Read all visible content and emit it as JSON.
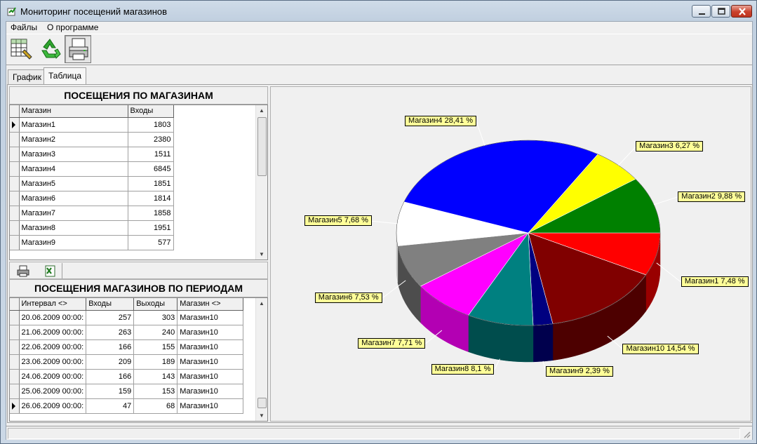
{
  "window": {
    "title": "Мониторинг посещений магазинов"
  },
  "menu": {
    "files": "Файлы",
    "about": "О программе"
  },
  "toolbar": {
    "buttons": [
      "table-grid-icon",
      "recycle-icon",
      "printer-icon"
    ]
  },
  "tabs": [
    {
      "label": "График"
    },
    {
      "label": "Таблица"
    }
  ],
  "visits_by_store": {
    "title": "ПОСЕЩЕНИЯ ПО МАГАЗИНАМ",
    "columns": [
      "Магазин",
      "Входы"
    ],
    "rows": [
      {
        "store": "Магазин1",
        "entries": "1803"
      },
      {
        "store": "Магазин2",
        "entries": "2380"
      },
      {
        "store": "Магазин3",
        "entries": "1511"
      },
      {
        "store": "Магазин4",
        "entries": "6845"
      },
      {
        "store": "Магазин5",
        "entries": "1851"
      },
      {
        "store": "Магазин6",
        "entries": "1814"
      },
      {
        "store": "Магазин7",
        "entries": "1858"
      },
      {
        "store": "Магазин8",
        "entries": "1951"
      },
      {
        "store": "Магазин9",
        "entries": "577"
      }
    ]
  },
  "visits_by_period": {
    "title": "ПОСЕЩЕНИЯ МАГАЗИНОВ ПО ПЕРИОДАМ",
    "columns": [
      "Интервал <>",
      "Входы",
      "Выходы",
      "Магазин <>"
    ],
    "rows": [
      {
        "interval": "20.06.2009 00:00:",
        "entries": "257",
        "exits": "303",
        "store": "Магазин10"
      },
      {
        "interval": "21.06.2009 00:00:",
        "entries": "263",
        "exits": "240",
        "store": "Магазин10"
      },
      {
        "interval": "22.06.2009 00:00:",
        "entries": "166",
        "exits": "155",
        "store": "Магазин10"
      },
      {
        "interval": "23.06.2009 00:00:",
        "entries": "209",
        "exits": "189",
        "store": "Магазин10"
      },
      {
        "interval": "24.06.2009 00:00:",
        "entries": "166",
        "exits": "143",
        "store": "Магазин10"
      },
      {
        "interval": "25.06.2009 00:00:",
        "entries": "159",
        "exits": "153",
        "store": "Магазин10"
      },
      {
        "interval": "26.06.2009 00:00:",
        "entries": "47",
        "exits": "68",
        "store": "Магазин10"
      }
    ]
  },
  "chart_data": {
    "type": "pie",
    "slices": [
      {
        "label": "Магазин1 7,48 %",
        "value": 7.48,
        "color": "#ff0000",
        "dark": "#990000"
      },
      {
        "label": "Магазин10 14,54 %",
        "value": 14.54,
        "color": "#800000",
        "dark": "#4d0000"
      },
      {
        "label": "Магазин9 2,39 %",
        "value": 2.39,
        "color": "#000080",
        "dark": "#00004d"
      },
      {
        "label": "Магазин8 8,1 %",
        "value": 8.1,
        "color": "#008080",
        "dark": "#004d4d"
      },
      {
        "label": "Магазин7 7,71 %",
        "value": 7.71,
        "color": "#ff00ff",
        "dark": "#b300b3"
      },
      {
        "label": "Магазин6 7,53 %",
        "value": 7.53,
        "color": "#808080",
        "dark": "#4d4d4d"
      },
      {
        "label": "Магазин5 7,68 %",
        "value": 7.68,
        "color": "#ffffff",
        "dark": "#c8c8c8"
      },
      {
        "label": "Магазин4 28,41 %",
        "value": 28.41,
        "color": "#0000ff",
        "dark": "#00009a"
      },
      {
        "label": "Магазин3 6,27 %",
        "value": 6.27,
        "color": "#ffff00",
        "dark": "#b3b300"
      },
      {
        "label": "Магазин2 9,88 %",
        "value": 9.88,
        "color": "#008000",
        "dark": "#004d00"
      }
    ]
  }
}
